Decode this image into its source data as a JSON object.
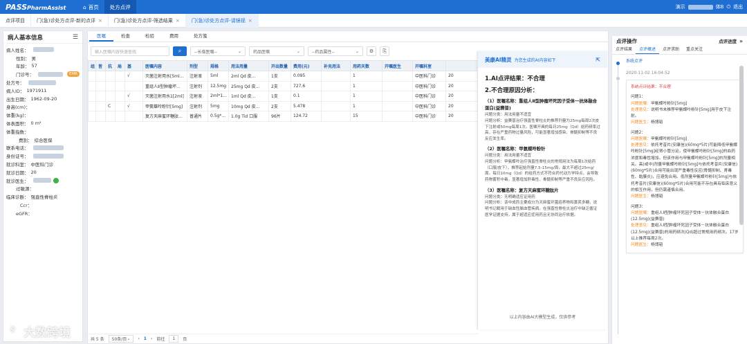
{
  "topbar": {
    "logo_main": "PASS",
    "logo_sub": "PharmAssist",
    "nav": [
      {
        "label": "首页",
        "icon": "home-icon"
      },
      {
        "label": "处方点评"
      }
    ],
    "user_text": "演示",
    "user_suffix": "体B",
    "logout": "退出"
  },
  "page_tabs": [
    {
      "label": "点评项目"
    },
    {
      "label": "门(急)诊处方点评-新的点评"
    },
    {
      "label": "门(急)诊处方点评-筛选结果"
    },
    {
      "label": "门(急)诊处方点评-请镜视"
    }
  ],
  "patient": {
    "title": "病人基本信息",
    "fields": [
      {
        "k": "病人姓名：",
        "v": ""
      },
      {
        "k": "性别：",
        "v": "男"
      },
      {
        "k": "年龄：",
        "v": "57"
      },
      {
        "k": "门诊号：",
        "v": ""
      },
      {
        "k": "处方号：",
        "v": ""
      },
      {
        "k": "病人ID：",
        "v": "1971911"
      },
      {
        "k": "出生日期：",
        "v": "1962-09-20"
      },
      {
        "k": "身高(cm)：",
        "v": ""
      },
      {
        "k": "体重(kg)：",
        "v": ""
      },
      {
        "k": "体表面积：",
        "v": "0 m²"
      },
      {
        "k": "体重指数：",
        "v": ""
      },
      {
        "k": "费别：",
        "v": "综合医保"
      },
      {
        "k": "联系电话：",
        "v": ""
      },
      {
        "k": "身份证号：",
        "v": ""
      },
      {
        "k": "就诊科室：",
        "v": "中医科门诊"
      },
      {
        "k": "就诊日期：",
        "v": "20"
      },
      {
        "k": "就诊医生：",
        "v": ""
      },
      {
        "k": "过敏源：",
        "v": ""
      },
      {
        "k": "临床诊断：",
        "v": "强直性脊柱炎"
      },
      {
        "k": "Ccr：",
        "v": ""
      },
      {
        "k": "eGFR：",
        "v": ""
      }
    ],
    "emr_badge": "EMR"
  },
  "subtabs": [
    "医嘱",
    "检查",
    "检验",
    "费用",
    "处方笺"
  ],
  "filters": {
    "search_placeholder": "输入医嘱内容快速查找",
    "sel1": "--长临医嘱--",
    "sel2": "药品医嘱",
    "sel3": "--药品属性--"
  },
  "table": {
    "headers": [
      "组",
      "皆",
      "抗",
      "局",
      "基",
      "医嘱内容",
      "剂型",
      "规格",
      "用法用量",
      "开出数量",
      "费用(元)",
      "补充用法",
      "用药天数",
      "开嘱医生",
      "开嘱科室",
      ""
    ],
    "rows": [
      [
        "",
        "",
        "",
        "",
        "√",
        "灭菌注射用水[5ml...",
        "注射液",
        "5ml",
        "2ml Qd 皮...",
        "1支",
        "0.095",
        "",
        "1",
        "",
        "中医科门诊",
        "20"
      ],
      [
        "",
        "",
        "",
        "",
        "",
        "重组人Ⅱ型肿瘤坏...",
        "注射剂",
        "12.5mg",
        "25mg Qd 皮...",
        "2支",
        "727.6",
        "",
        "1",
        "",
        "中医科门诊",
        "20"
      ],
      [
        "",
        "",
        "",
        "",
        "√",
        "灭菌注射用水1[2ml]",
        "注射液",
        "2ml*1...",
        "1ml Qd 皮...",
        "1支",
        "0.1",
        "",
        "1",
        "",
        "中医科门诊",
        "20"
      ],
      [
        "",
        "",
        "C",
        "",
        "√",
        "甲氨蝶呤粉针[5mg]",
        "注射剂",
        "5mg",
        "10mg Qd 皮...",
        "2支",
        "5.478",
        "",
        "1",
        "",
        "中医科门诊",
        "20"
      ],
      [
        "",
        "",
        "",
        "",
        "",
        "复方天麻蜜环糖肽...",
        "普通片",
        "0.5g*...",
        "1.0g Tid 口服",
        "96片",
        "124.72",
        "",
        "15",
        "",
        "中医科门诊",
        "20"
      ]
    ]
  },
  "pager": {
    "total": "共 5 条",
    "page_size": "50条/页",
    "current": "1",
    "goto_label": "前往",
    "goto_value": "1",
    "page_suffix": "页"
  },
  "ai": {
    "title": "美康AI精灵",
    "subtitle": "为您生成的AI内容如下",
    "h1": "1.AI点评结果：不合理",
    "h2": "2.不合理原因分析：",
    "items": [
      {
        "title": "（1）医嘱名称：重组人Ⅱ型肿瘤坏死因子受体一抗体融合蛋白(益赛普)",
        "lines": [
          "问题分类：用法用量不适宜",
          "问题分析：益赛普治疗强直性脊柱炎的推荐剂量为25mg每周2次皮下注射或50mg每周1次。医嘱开具的每日25mg（Qd）给药频率过高，存在严重药物过量风险，可能显著增加感染、骨髓抑制等不良反应发生率。"
        ]
      },
      {
        "title": "（2）医嘱名称：甲氨蝶呤粉针",
        "lines": [
          "问题分类：用法用量不适宜",
          "问题分析：甲氨蝶呤治疗强直性脊柱炎的常规用法为每周1次给药（口服/皮下），推荐起始剂量7.5-15mg/周，最大不超过25mg/周。每日10mg（Qd）的给药方式不符合药代动力学特点，会导致药物蓄积中毒，显著增加肝毒性、骨髓抑制等严重不良反应风险。"
        ]
      },
      {
        "title": "（3）医嘱名称：复方天麻蜜环糖肽片",
        "lines": [
          "问题分类：无明确适应证用药",
          "问题分析：该中成药主要成分为天麻蜜环菌培养物和黄芪多糖，说明书记载用于缺血性脑血管疾病。在强直性脊柱炎治疗中缺乏循证医学证据支持，属于超适应症用药且无协同治疗依据。"
        ]
      }
    ],
    "footer": "以上内容由AI大模型生成，仅供参考"
  },
  "right": {
    "title": "点评操作",
    "title_right": "点评进度",
    "tabs": [
      "点评结果",
      "点评概述",
      "点评求助",
      "重点关注"
    ],
    "status_link": "系统点评",
    "date": "2020-11-02 16:04:52",
    "card_head": "系统点评结果：不合理",
    "problems": [
      {
        "no": "问题1：",
        "name": "甲氨蝶呤粉针[5mg]",
        "opinion": "说明书未推荐甲氨蝶呤粉针[5mg]用于皮下注射。",
        "doctor": "杨博韬"
      },
      {
        "no": "问题2：",
        "name": "甲氨蝶呤粉针[5mg]",
        "opinion": "依托考昔片(安康信)(60mg*5片)可能降低甲氨蝶呤粉针[5mg]经肾小管分泌，使甲氨蝶呤粉针[5mg]的血药浓度和毒性增加。但该作用与甲氨蝶呤粉针[5mg]的剂量相关。高(或中)剂量甲氨蝶呤粉针[5mg]与依托考昔片(安康信)(60mg*5片)合用可能出现严重毒性反应(骨髓抑制、肾毒性、黏膜炎)，应避免合用。低剂量甲氨蝶呤粉针[5mg]与依托考昔片(安康信)(60mg*5片)合用可能不存在具有临床意义的相互作用，但仍需谨慎合用。",
        "doctor": "杨博韬"
      },
      {
        "no": "问题3：",
        "name": "重组人Ⅱ型肿瘤坏死因子受体－抗体融合蛋白(12.5mg)(益赛普)",
        "opinion": "重组人Ⅱ型肿瘤坏死因子受体－抗体融合蛋白(12.5mg)(益赛普)的用药频次(Qd)超过常规用药频次。17岁以上推荐每周2次。",
        "doctor": "杨博韬"
      }
    ],
    "labels": {
      "name": "问题医嘱：",
      "opinion": "处理意见：",
      "doctor": "问题医生："
    }
  },
  "watermark": "大数跨境"
}
